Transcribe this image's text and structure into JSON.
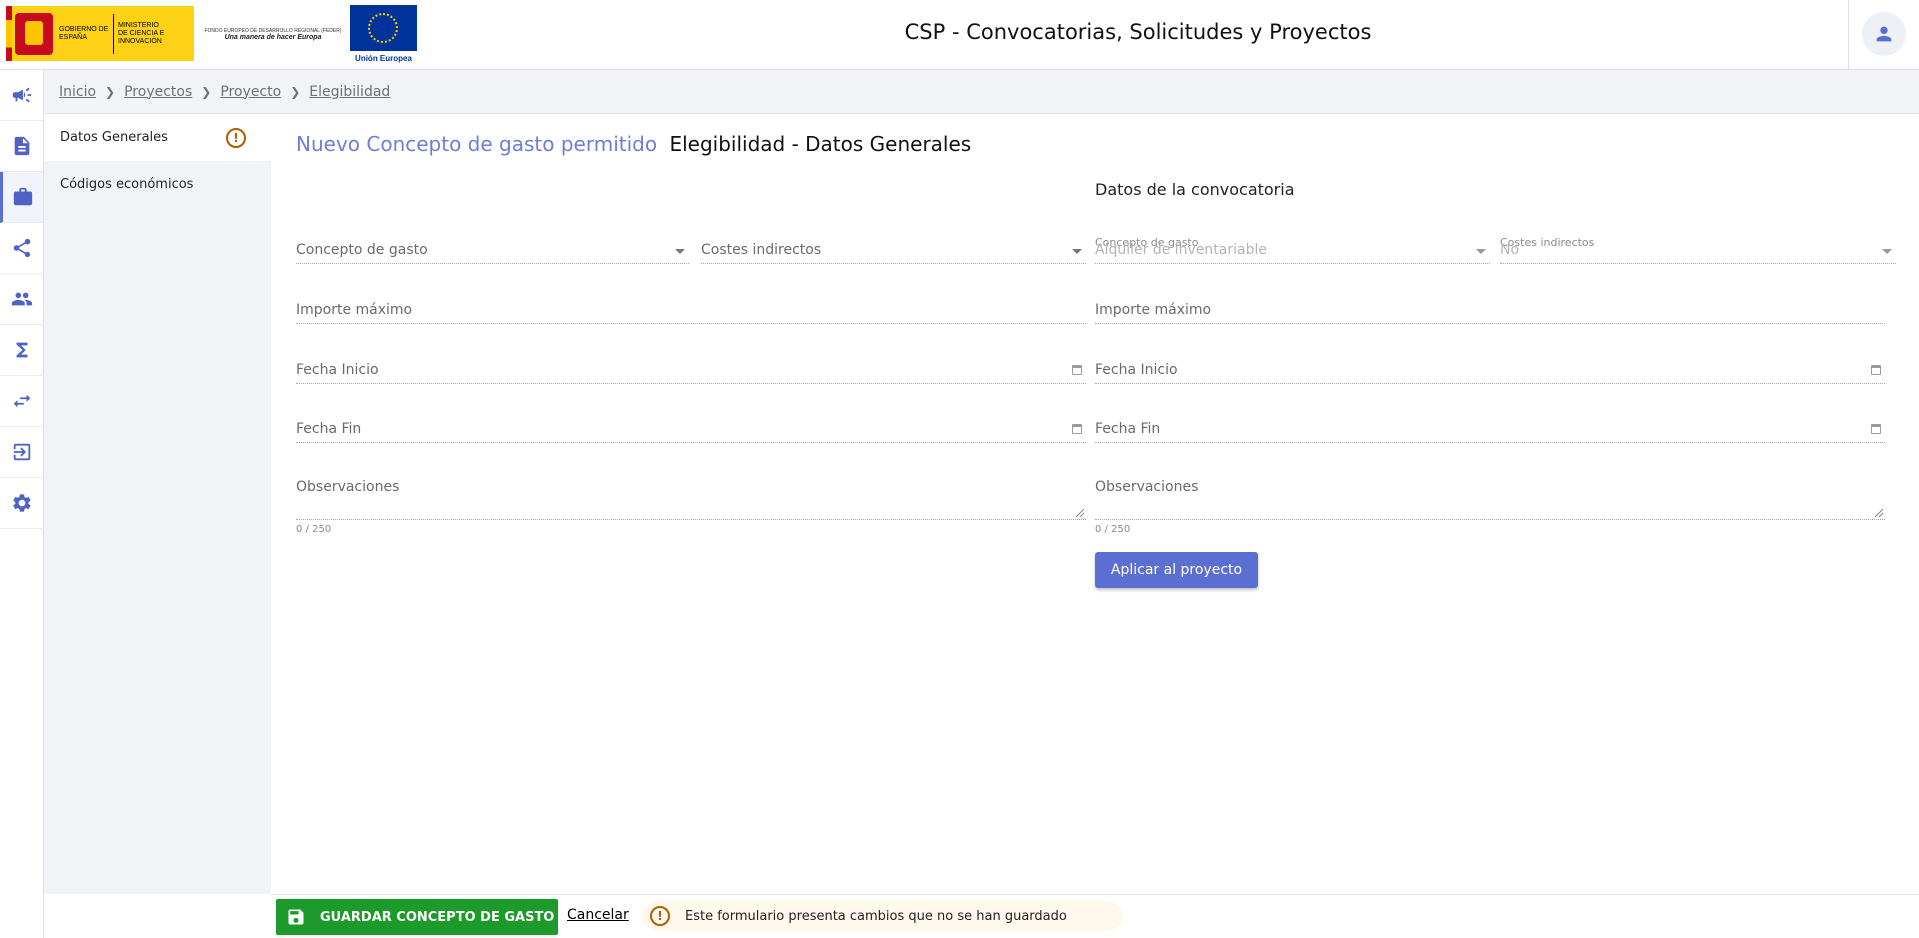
{
  "header": {
    "app_title": "CSP - Convocatorias, Solicitudes y Proyectos",
    "logo_gobierno": "GOBIERNO DE ESPAÑA",
    "logo_ministerio": "MINISTERIO DE CIENCIA E INNOVACIÓN",
    "logo_feder_line1": "FONDO EUROPEO DE DESARROLLO REGIONAL (FEDER)",
    "logo_feder_line2": "Una manera de hacer Europa",
    "logo_eu": "Unión Europea"
  },
  "breadcrumb": {
    "items": [
      "Inicio",
      "Proyectos",
      "Proyecto",
      "Elegibilidad"
    ]
  },
  "left_nav": {
    "items": [
      {
        "label": "Datos Generales",
        "warning": "!"
      },
      {
        "label": "Códigos económicos"
      }
    ]
  },
  "page": {
    "title_main": "Nuevo Concepto de gasto permitido",
    "title_sub": "Elegibilidad - Datos Generales",
    "section_convocatoria": "Datos de la convocatoria"
  },
  "form_left": {
    "concepto_gasto": "Concepto de gasto",
    "costes_indirectos": "Costes indirectos",
    "importe_maximo": "Importe máximo",
    "fecha_inicio": "Fecha Inicio",
    "fecha_fin": "Fecha Fin",
    "observaciones": "Observaciones",
    "counter": "0 / 250"
  },
  "form_right": {
    "concepto_gasto_label": "Concepto de gasto",
    "concepto_gasto_value": "Alquiler de inventariable",
    "costes_indirectos_label": "Costes indirectos",
    "costes_indirectos_value": "No",
    "importe_maximo": "Importe máximo",
    "fecha_inicio": "Fecha Inicio",
    "fecha_fin": "Fecha Fin",
    "observaciones": "Observaciones",
    "counter": "0 / 250",
    "apply_button": "Aplicar al proyecto"
  },
  "footer": {
    "save_button": "GUARDAR CONCEPTO DE GASTO",
    "cancel_link": "Cancelar",
    "unsaved_message": "Este formulario presenta cambios que no se han guardado",
    "warning_symbol": "!"
  },
  "icons": {
    "sidebar": [
      "megaphone-icon",
      "document-icon",
      "briefcase-icon",
      "share-icon",
      "people-icon",
      "sigma-icon",
      "swap-icon",
      "logout-icon",
      "gear-icon"
    ]
  },
  "colors": {
    "accent": "#5a6fd1",
    "save_green": "#1c9a2a",
    "warning": "#b25e00"
  }
}
